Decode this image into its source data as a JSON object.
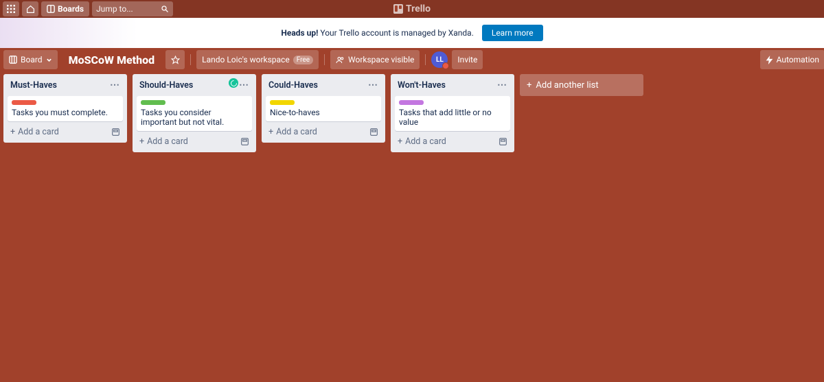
{
  "app": {
    "name": "Trello"
  },
  "topbar": {
    "boards_label": "Boards",
    "jump_placeholder": "Jump to..."
  },
  "banner": {
    "heads_up": "Heads up!",
    "message": " Your Trello account is managed by Xanda.",
    "learn_more": "Learn more"
  },
  "boardbar": {
    "board_btn": "Board",
    "board_name": "MoSCoW Method",
    "workspace": "Lando Loic's workspace",
    "free": "Free",
    "visibility": "Workspace visible",
    "invite": "Invite",
    "automation": "Automation",
    "avatar_initials": "LL"
  },
  "lists": [
    {
      "title": "Must-Haves",
      "label_color": "#eb5a46",
      "card": "Tasks you must complete.",
      "has_grammarly": false
    },
    {
      "title": "Should-Haves",
      "label_color": "#61bd4f",
      "card": "Tasks you consider important but not vital.",
      "has_grammarly": true
    },
    {
      "title": "Could-Haves",
      "label_color": "#f2d600",
      "card": "Nice-to-haves",
      "has_grammarly": false
    },
    {
      "title": "Won't-Haves",
      "label_color": "#c377e0",
      "card": "Tasks that add little or no value",
      "has_grammarly": false
    }
  ],
  "strings": {
    "add_card": "Add a card",
    "add_list": "Add another list"
  },
  "colors": {
    "board_bg": "#a1412b",
    "primary_button": "#0079bf"
  }
}
